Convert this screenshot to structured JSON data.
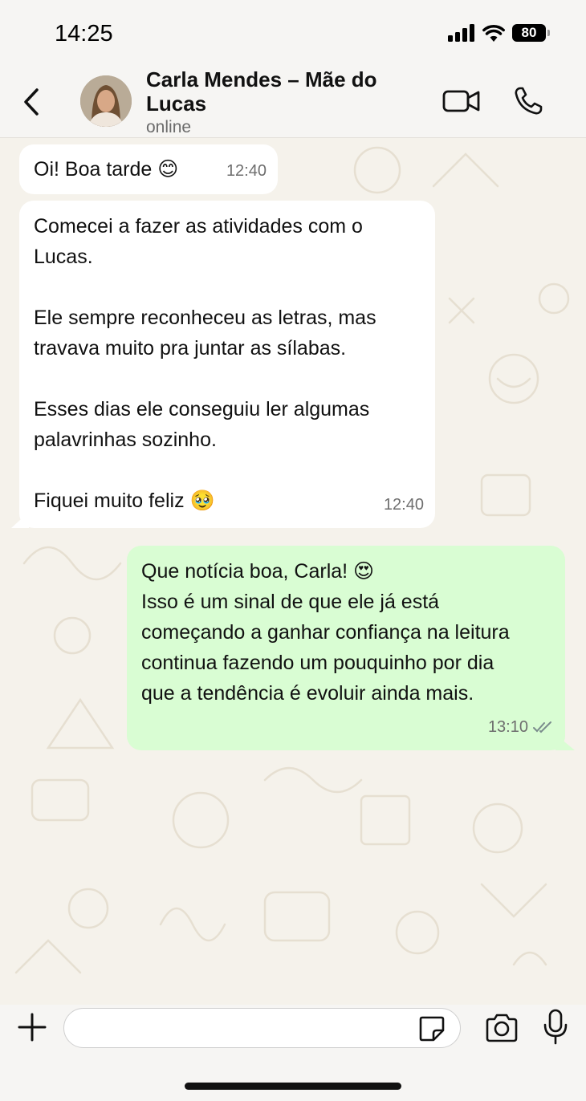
{
  "status_bar": {
    "time": "14:25",
    "battery": "80"
  },
  "header": {
    "contact_name": "Carla Mendes – Mãe do Lucas",
    "contact_status": "online"
  },
  "messages": [
    {
      "direction": "incoming",
      "text": "Oi! Boa tarde 😊",
      "time": "12:40"
    },
    {
      "direction": "incoming",
      "text": "Comecei a fazer as atividades com o\nLucas.\n\nEle sempre reconheceu as letras, mas\ntravava muito pra juntar as sílabas.\n\nEsses dias ele conseguiu ler algumas\npalavrinhas sozinho.\n\nFiquei muito feliz 🥹",
      "time": "12:40"
    },
    {
      "direction": "outgoing",
      "text": "Que notícia boa, Carla! 😍\nIsso é um sinal de que ele já está\ncomeçando a ganhar confiança na leitura\ncontinua fazendo um pouquinho por dia\nque a tendência é evoluir ainda mais.",
      "time": "13:10",
      "read_status": "read"
    }
  ],
  "input": {
    "value": "",
    "placeholder": ""
  },
  "colors": {
    "outgoing_bubble": "#d9fdd3",
    "incoming_bubble": "#ffffff",
    "chat_background": "#f5f2eb",
    "header_background": "#f6f5f3"
  },
  "icons": [
    "signal-icon",
    "wifi-icon",
    "battery-icon",
    "back-icon",
    "video-call-icon",
    "phone-icon",
    "plus-icon",
    "sticker-icon",
    "camera-icon",
    "mic-icon",
    "double-check-icon"
  ]
}
